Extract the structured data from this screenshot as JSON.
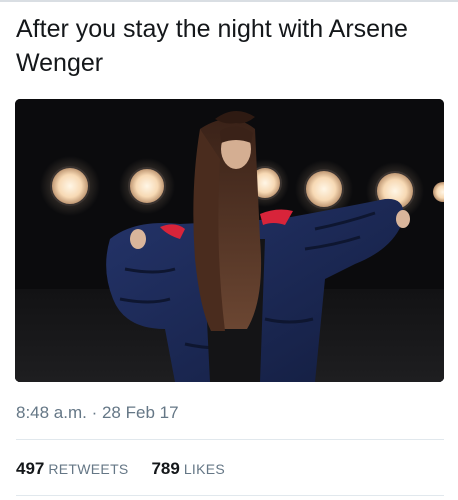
{
  "tweet": {
    "text": "After you stay the night with Arsene Wenger",
    "timestamp": "8:48 a.m. · 28 Feb 17"
  },
  "stats": {
    "retweets_count": "497",
    "retweets_label": "RETWEETS",
    "likes_count": "789",
    "likes_label": "LIKES"
  },
  "colors": {
    "text": "#14171a",
    "secondary": "#657786",
    "divider": "#e1e8ed",
    "jacket": "#1c2a55",
    "jacket_lining": "#d8243a",
    "lamp": "#ffe6c4"
  }
}
